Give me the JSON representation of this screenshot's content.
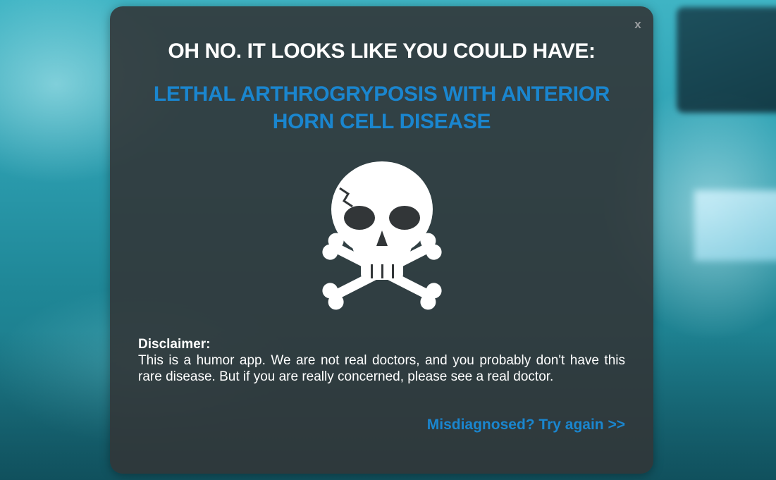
{
  "modal": {
    "close_label": "x",
    "heading": "OH NO. IT LOOKS LIKE YOU COULD HAVE:",
    "diagnosis": "LETHAL ARTHROGRYPOSIS WITH ANTERIOR HORN CELL DISEASE",
    "icon": "skull-crossbones-icon",
    "disclaimer_title": "Disclaimer:",
    "disclaimer_body": "This is a humor app. We are not real doctors, and you probably don't have this rare disease. But if you are really concerned, please see a real doctor.",
    "retry_link": "Misdiagnosed? Try again >>"
  },
  "colors": {
    "accent": "#1a86cf",
    "modal_bg": "#323638",
    "heading_text": "#ffffff"
  }
}
